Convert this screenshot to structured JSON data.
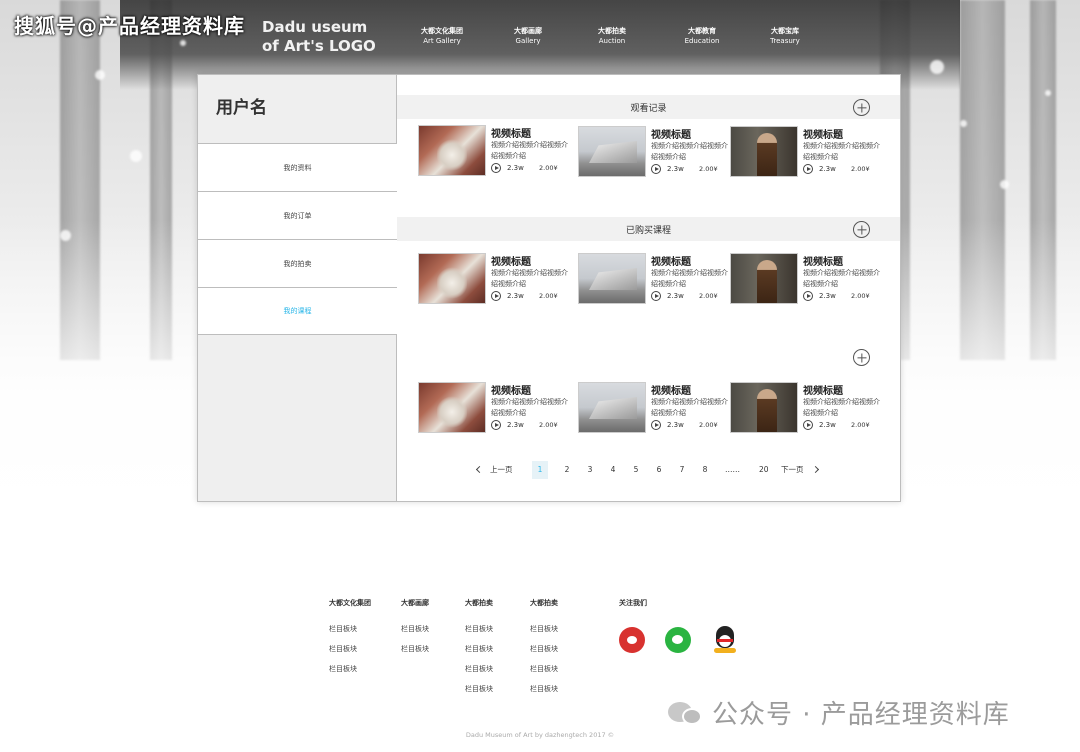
{
  "watermark_top": "搜狐号@产品经理资料库",
  "logo": {
    "line1": "Dadu useum",
    "line2": "of Art's LOGO"
  },
  "nav": [
    {
      "cn": "大都文化集团",
      "en": "Art  Gallery"
    },
    {
      "cn": "大都画廊",
      "en": "Gallery"
    },
    {
      "cn": "大都拍卖",
      "en": "Auction"
    },
    {
      "cn": "大都教育",
      "en": "Education"
    },
    {
      "cn": "大都宝库",
      "en": "Treasury"
    }
  ],
  "sidebar": {
    "username": "用户名",
    "items": [
      "我的资料",
      "我的订单",
      "我的拍卖",
      "我的课程"
    ],
    "active_index": 3
  },
  "sections": {
    "history_title": "观看记录",
    "purchased_title": "已购买课程"
  },
  "video": {
    "title": "视频标题",
    "desc": "视频介绍视频介绍视频介绍视频介绍",
    "views": "2.3w",
    "price": "2.00¥"
  },
  "pager": {
    "prev": "上一页",
    "next": "下一页",
    "pages": [
      "1",
      "2",
      "3",
      "4",
      "5",
      "6",
      "7",
      "8"
    ],
    "ellipsis": "……",
    "last": "20",
    "current": "1"
  },
  "footer": {
    "columns": [
      {
        "head": "大都文化集团",
        "links": [
          "栏目板块",
          "栏目板块",
          "栏目板块"
        ]
      },
      {
        "head": "大都画廊",
        "links": [
          "栏目板块",
          "栏目板块"
        ]
      },
      {
        "head": "大都拍卖",
        "links": [
          "栏目板块",
          "栏目板块",
          "栏目板块",
          "栏目板块"
        ]
      },
      {
        "head": "大都拍卖",
        "links": [
          "栏目板块",
          "栏目板块",
          "栏目板块",
          "栏目板块"
        ]
      }
    ],
    "follow": "关注我们",
    "social_icons": [
      "weibo-icon",
      "wechat-icon",
      "qq-icon"
    ],
    "copyright": "Dadu Museum of Art by dazhengtech 2017 ©"
  },
  "watermark_bottom": "公众号 · 产品经理资料库",
  "colors": {
    "accent": "#29b6e8",
    "weibo": "#d8322f",
    "wechat": "#2ab441"
  }
}
